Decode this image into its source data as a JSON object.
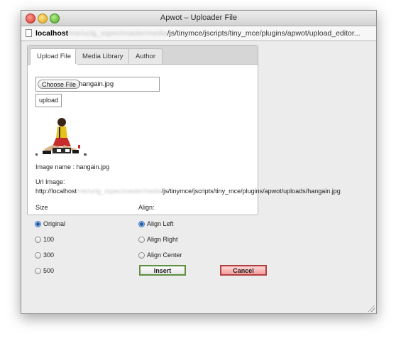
{
  "window": {
    "title": "Apwot – Uploader File"
  },
  "address_bar": {
    "host": "localhost",
    "blurred_segment": "/me/uclg_sspec/master/media",
    "path": "/js/tinymce/jscripts/tiny_mce/plugins/apwot/upload_editor..."
  },
  "tabs": [
    {
      "label": "Upload File",
      "active": true
    },
    {
      "label": "Media Library",
      "active": false
    },
    {
      "label": "Author",
      "active": false
    }
  ],
  "upload": {
    "choose_label": "Choose File",
    "file_name": "hangain.jpg",
    "upload_label": "upload"
  },
  "image_info": {
    "name_label": "Image name : hangain.jpg",
    "url_label": "Url Image:",
    "url_prefix": "http://localhost",
    "url_blurred": "/me/uclg_sspec/master/media",
    "url_suffix": "/js/tinymce/jscripts/tiny_mce/plugins/apwot/uploads/hangain.jpg"
  },
  "size": {
    "heading": "Size",
    "options": [
      {
        "label": "Original",
        "selected": true
      },
      {
        "label": "100",
        "selected": false
      },
      {
        "label": "300",
        "selected": false
      },
      {
        "label": "500",
        "selected": false
      }
    ]
  },
  "align": {
    "heading": "Align:",
    "options": [
      {
        "label": "Align Left",
        "selected": true
      },
      {
        "label": "Align Right",
        "selected": false
      },
      {
        "label": "Align Center",
        "selected": false
      }
    ]
  },
  "actions": {
    "insert_label": "Insert",
    "cancel_label": "Cancel"
  },
  "colors": {
    "insert_border": "#5f8f3f",
    "cancel_border": "#b34040",
    "cancel_fill": "#f29a9a",
    "radio_selected": "#1f4f9c"
  },
  "icons": [
    "close-icon",
    "minimize-icon",
    "zoom-icon",
    "page-icon",
    "resize-grip-icon"
  ]
}
